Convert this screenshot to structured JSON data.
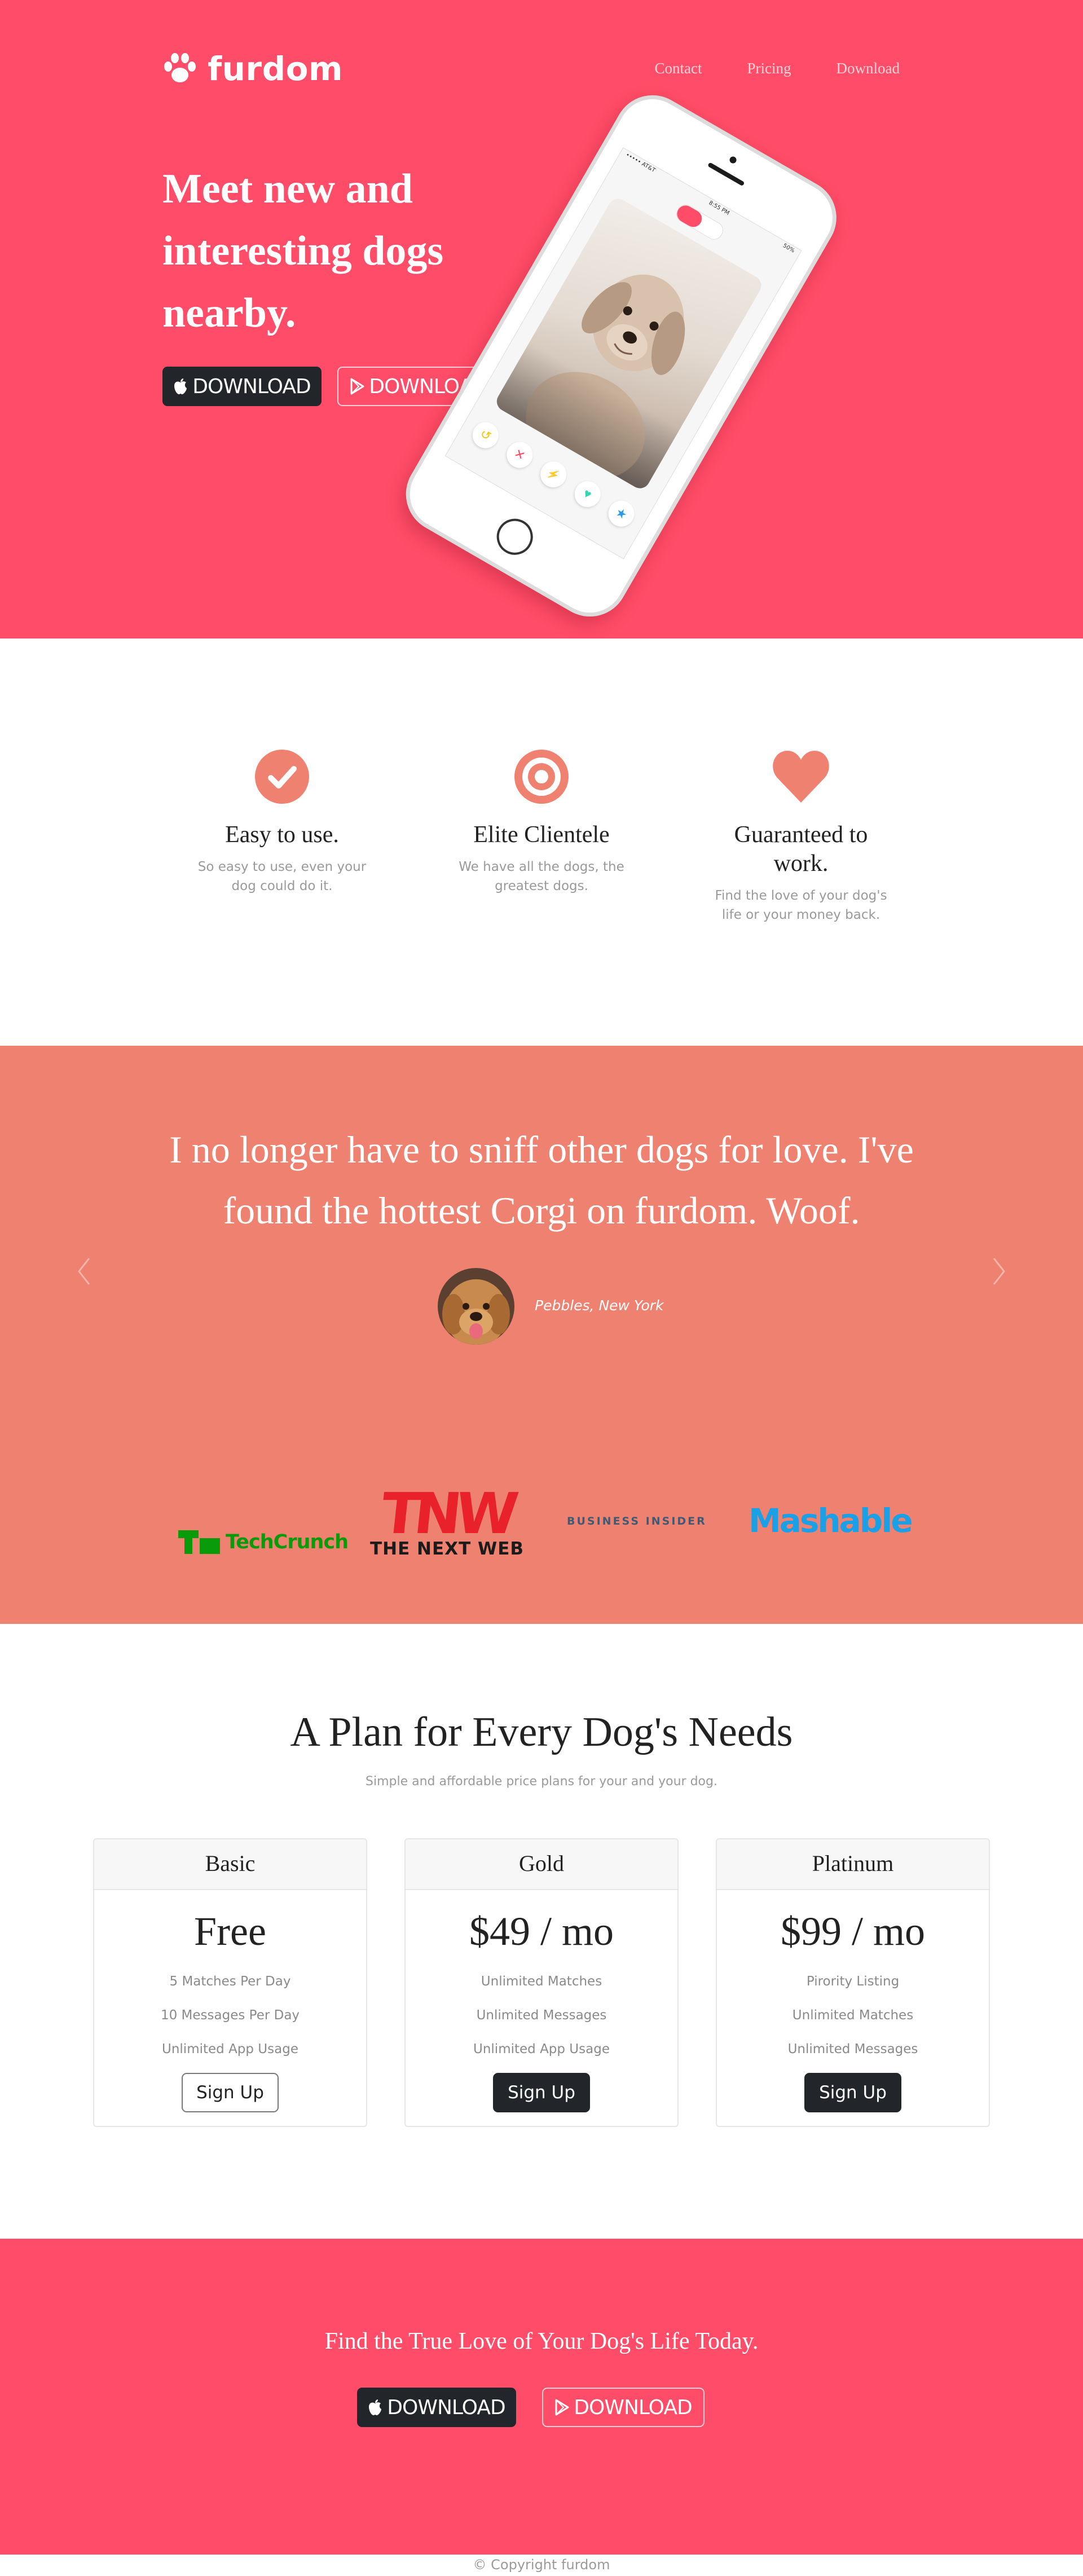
{
  "brand": {
    "name": "furdom",
    "icon": "paw-icon"
  },
  "nav": {
    "items": [
      "Contact",
      "Pricing",
      "Download"
    ]
  },
  "hero": {
    "headline": "Meet new and interesting dogs nearby.",
    "buttons": [
      {
        "label": "DOWNLOAD",
        "icon": "apple-icon",
        "style": "dark"
      },
      {
        "label": "DOWNLOAD",
        "icon": "play-store-icon",
        "style": "outline"
      }
    ],
    "phone": {
      "carrier": "••••• AT&T",
      "time": "8:55 PM",
      "battery": "50%"
    }
  },
  "features": [
    {
      "icon": "checkmark-circle-icon",
      "title": "Easy to use.",
      "text": "So easy to use, even your dog could do it."
    },
    {
      "icon": "target-icon",
      "title": "Elite Clientele",
      "text": "We have all the dogs, the greatest dogs."
    },
    {
      "icon": "heart-icon",
      "title": "Guaranteed to work.",
      "text": "Find the love of your dog's life or your money back."
    }
  ],
  "testimonial": {
    "quote": "I no longer have to sniff other dogs for love. I've found the hottest Corgi on furdom. Woof.",
    "author": "Pebbles, New York",
    "prev_icon": "chevron-left-icon",
    "next_icon": "chevron-right-icon"
  },
  "press": {
    "techcrunch": "TechCrunch",
    "tnw_big": "TNW",
    "tnw_small": "THE NEXT WEB",
    "business_insider": "BUSINESS INSIDER",
    "mashable": "Mashable"
  },
  "pricing": {
    "title": "A Plan for Every Dog's Needs",
    "subtitle": "Simple and affordable price plans for your and your dog.",
    "plans": [
      {
        "name": "Basic",
        "price": "Free",
        "features": [
          "5 Matches Per Day",
          "10 Messages Per Day",
          "Unlimited App Usage"
        ],
        "button": "Sign Up",
        "style": "outline"
      },
      {
        "name": "Gold",
        "price": "$49 / mo",
        "features": [
          "Unlimited Matches",
          "Unlimited Messages",
          "Unlimited App Usage"
        ],
        "button": "Sign Up",
        "style": "dark"
      },
      {
        "name": "Platinum",
        "price": "$99 / mo",
        "features": [
          "Pirority Listing",
          "Unlimited Matches",
          "Unlimited Messages"
        ],
        "button": "Sign Up",
        "style": "dark"
      }
    ]
  },
  "cta": {
    "title": "Find the True Love of Your Dog's Life Today.",
    "buttons": [
      {
        "label": "DOWNLOAD",
        "icon": "apple-icon",
        "style": "dark"
      },
      {
        "label": "DOWNLOAD",
        "icon": "play-store-icon",
        "style": "outline"
      }
    ]
  },
  "footer": {
    "copyright": "© Copyright furdom"
  },
  "colors": {
    "primary": "#ff4c68",
    "testimonial_bg": "#ef8170",
    "feature_icon": "#ef8170",
    "dark_button": "#222529",
    "muted_text": "#9a9a9a"
  }
}
